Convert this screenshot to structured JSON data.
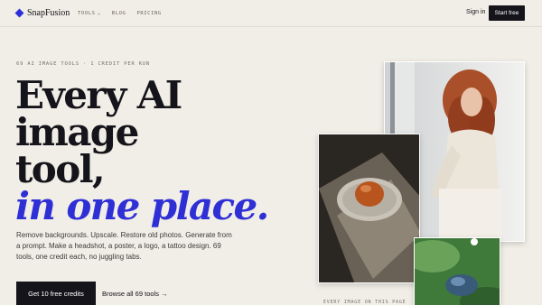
{
  "nav": {
    "brand": "SnapFusion",
    "links": [
      {
        "label": "TOOLS",
        "dropdown": true
      },
      {
        "label": "BLOG",
        "dropdown": false
      },
      {
        "label": "PRICING",
        "dropdown": false
      }
    ],
    "sign_in": "Sign in",
    "start_free": "Start free"
  },
  "hero": {
    "eyebrow": "69 AI IMAGE TOOLS · 1 CREDIT PER RUN",
    "headline_line1": "Every AI image",
    "headline_line2": "tool,",
    "headline_accent": "in one place.",
    "description": "Remove backgrounds. Upscale. Restore old photos. Generate from a prompt. Make a headshot, a poster, a logo, a tattoo design. 69 tools, one credit each, no juggling tabs.",
    "cta_primary": "Get 10 free credits",
    "cta_secondary": "Browse all 69 tools →"
  },
  "gallery": {
    "caption": "EVERY IMAGE ON THIS PAGE"
  },
  "colors": {
    "background": "#f1eee7",
    "accent": "#2f2fd6",
    "ink": "#15141a"
  }
}
